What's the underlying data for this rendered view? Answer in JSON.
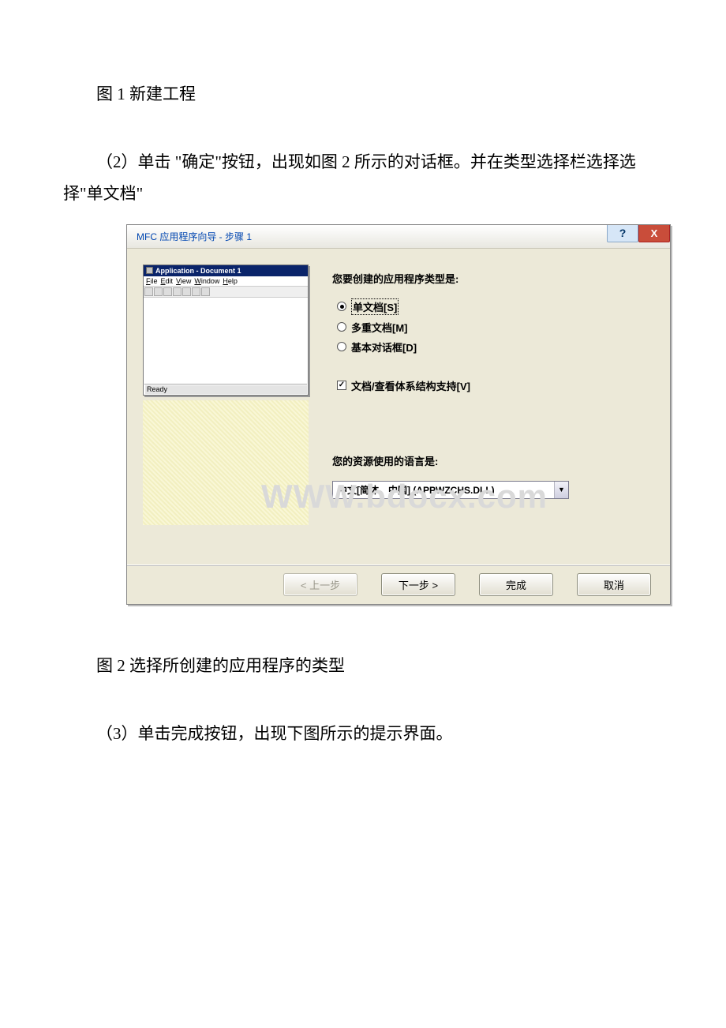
{
  "doc": {
    "caption1": "图 1 新建工程",
    "para2": "（2）单击 \"确定\"按钮，出现如图 2 所示的对话框。并在类型选择栏选择选择\"单文档\"",
    "caption2": "图 2 选择所创建的应用程序的类型",
    "para3": "（3）单击完成按钮，出现下图所示的提示界面。"
  },
  "dialog": {
    "title": "MFC 应用程序向导 - 步骤 1",
    "help": "?",
    "close": "X",
    "preview": {
      "title": "Application - Document 1",
      "menu": [
        "File",
        "Edit",
        "View",
        "Window",
        "Help"
      ],
      "status": "Ready"
    },
    "watermark": "WWW.bdocx.com",
    "q1": "您要创建的应用程序类型是:",
    "radios": {
      "single": "单文档[S]",
      "multi": "多重文档[M]",
      "dlg": "基本对话框[D]"
    },
    "check_docview": "文档/查看体系结构支持[V]",
    "q2": "您的资源使用的语言是:",
    "lang_value": "中文[简体，中国] (APPWZCHS.DLL)",
    "buttons": {
      "back": "< 上一步",
      "next": "下一步 >",
      "finish": "完成",
      "cancel": "取消"
    }
  }
}
